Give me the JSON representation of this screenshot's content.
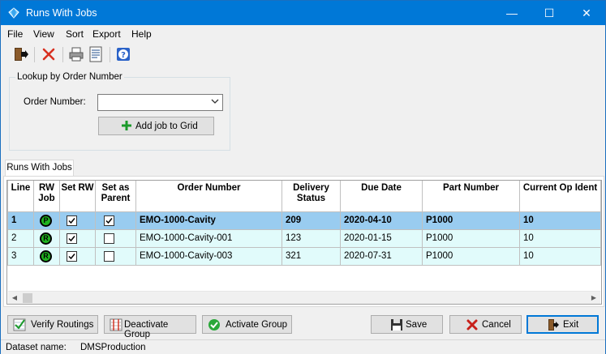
{
  "window": {
    "title": "Runs With Jobs",
    "minimize": "—",
    "maximize": "☐",
    "close": "✕"
  },
  "menu": [
    {
      "label": "File"
    },
    {
      "label": "View"
    },
    {
      "label": "Sort"
    },
    {
      "label": "Export"
    },
    {
      "label": "Help"
    }
  ],
  "toolbar": {
    "icons": [
      "exit-door-icon",
      "delete-x-icon",
      "print-icon",
      "print-preview-icon",
      "help-icon"
    ]
  },
  "lookup": {
    "group_title": "Lookup by Order Number",
    "order_label": "Order Number:",
    "order_value": "",
    "add_button": "Add job to Grid"
  },
  "tab": {
    "label": "Runs With Jobs"
  },
  "grid": {
    "columns": [
      "Line",
      "RW Job",
      "Set RW",
      "Set as Parent",
      "Order Number",
      "Delivery Status",
      "Due Date",
      "Part Number",
      "Current Op Ident"
    ],
    "rows": [
      {
        "line": "1",
        "rw_job": "P",
        "set_rw": true,
        "set_parent": true,
        "order": "EMO-1000-Cavity",
        "delivery": "209",
        "due": "2020-04-10",
        "part": "P1000",
        "op": "10",
        "selected": true
      },
      {
        "line": "2",
        "rw_job": "R",
        "set_rw": true,
        "set_parent": false,
        "order": "EMO-1000-Cavity-001",
        "delivery": "123",
        "due": "2020-01-15",
        "part": "P1000",
        "op": "10",
        "selected": false
      },
      {
        "line": "3",
        "rw_job": "R",
        "set_rw": true,
        "set_parent": false,
        "order": "EMO-1000-Cavity-003",
        "delivery": "321",
        "due": "2020-07-31",
        "part": "P1000",
        "op": "10",
        "selected": false
      }
    ]
  },
  "buttons": {
    "verify": "Verify Routings",
    "deactivate": "Deactivate Group",
    "activate": "Activate Group",
    "save": "Save",
    "cancel": "Cancel",
    "exit": "Exit"
  },
  "status": {
    "label": "Dataset name:",
    "value": "DMSProduction"
  },
  "colors": {
    "title_bar": "#0078d7",
    "selected_row": "#99ccf0",
    "row_bg": "#e1fbfb",
    "badge_green": "#1fb31f"
  }
}
